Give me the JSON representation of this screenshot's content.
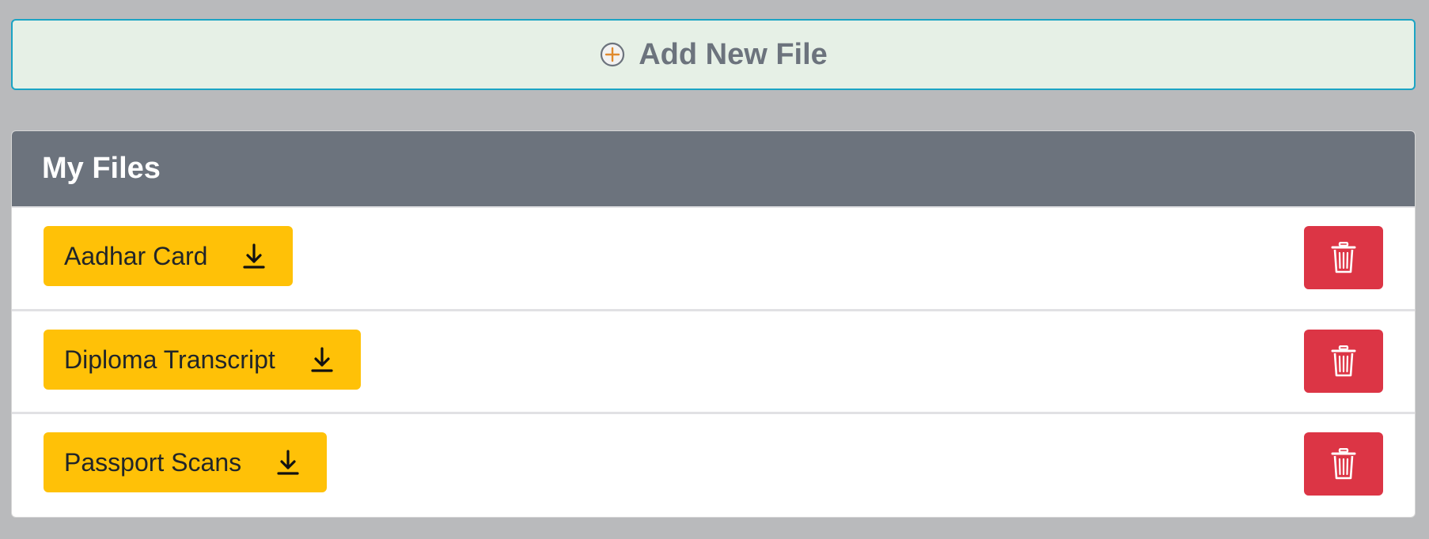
{
  "add_button": {
    "label": "Add New File",
    "icon": "plus-circle-icon"
  },
  "files_panel": {
    "title": "My Files",
    "files": [
      {
        "name": "Aadhar Card",
        "download_icon": "download-icon",
        "delete_icon": "trash-icon"
      },
      {
        "name": "Diploma Transcript",
        "download_icon": "download-icon",
        "delete_icon": "trash-icon"
      },
      {
        "name": "Passport Scans",
        "download_icon": "download-icon",
        "delete_icon": "trash-icon"
      }
    ]
  },
  "colors": {
    "background": "#b9babc",
    "add_button_bg": "#e6f0e6",
    "add_button_border": "#1ba4c4",
    "header_bg": "#6c737d",
    "download_bg": "#ffc107",
    "delete_bg": "#dc3545"
  }
}
